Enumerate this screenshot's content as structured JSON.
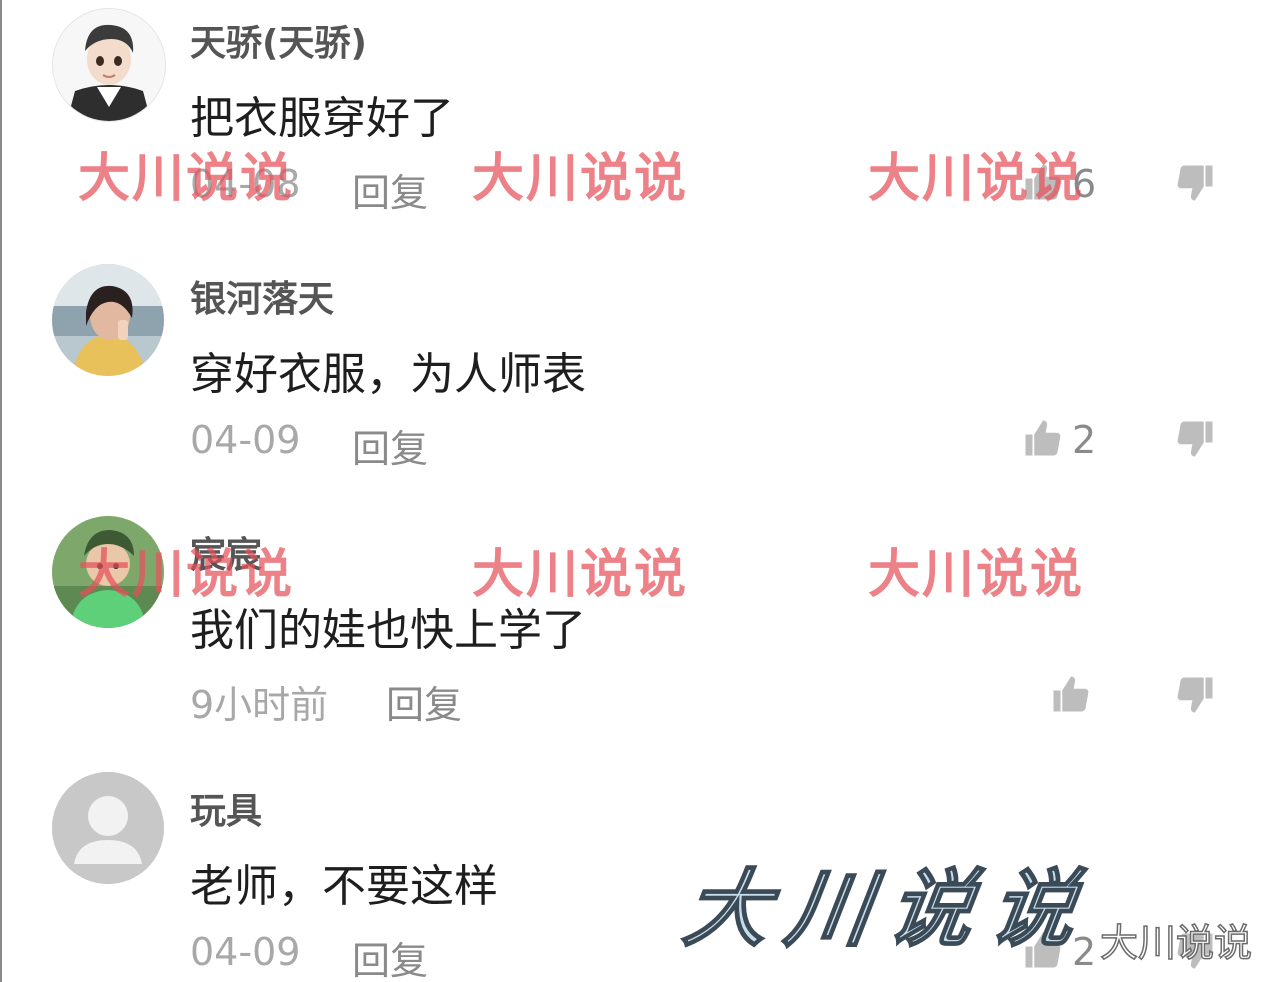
{
  "comments": [
    {
      "username": "天骄(天骄)",
      "content": "把衣服穿好了",
      "date": "04-08",
      "reply_label": "回复",
      "likes": "6",
      "avatar": "cartoon-boy-avatar"
    },
    {
      "username": "银河落天",
      "content": "穿好衣服，为人师表",
      "date": "04-09",
      "reply_label": "回复",
      "likes": "2",
      "avatar": "woman-photo-avatar"
    },
    {
      "username": "宸宸",
      "content": "我们的娃也快上学了",
      "date": "9小时前",
      "reply_label": "回复",
      "likes": "",
      "avatar": "child-photo-avatar"
    },
    {
      "username": "玩具",
      "content": "老师，不要这样",
      "date": "04-09",
      "reply_label": "回复",
      "likes": "2",
      "avatar": "default-user-avatar"
    }
  ],
  "watermark": {
    "text": "大川说说"
  },
  "icons": {
    "like": "thumbs-up-icon",
    "dislike": "thumbs-down-icon"
  },
  "colors": {
    "watermark_red": "#e6505a",
    "meta_gray": "#a8a8a8",
    "icon_gray": "#bdbdbd"
  }
}
